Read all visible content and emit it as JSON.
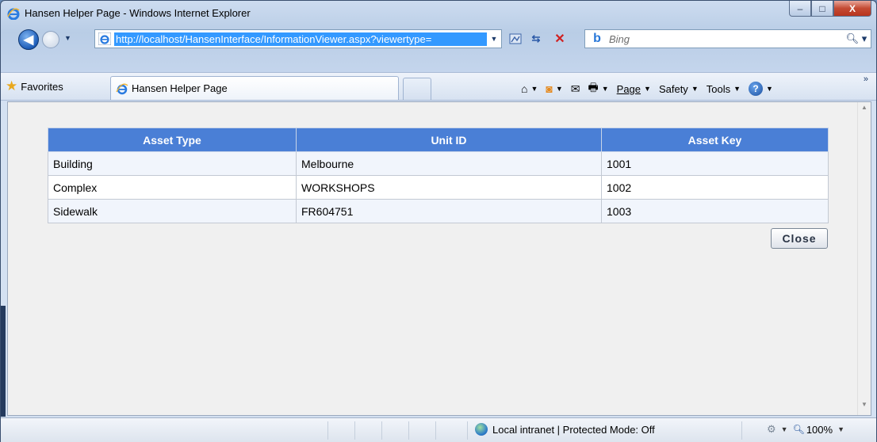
{
  "window": {
    "title": "Hansen Helper Page - Windows Internet Explorer",
    "controls": {
      "minimize": "–",
      "maximize": "□",
      "close": "X"
    }
  },
  "navigation": {
    "back_glyph": "◀",
    "address": "http://localhost/HansenInterface/InformationViewer.aspx?viewertype=",
    "search_placeholder": "Bing",
    "search_glyph": "⌕"
  },
  "favorites_bar": {
    "favorites_label": "Favorites",
    "tab_title": "Hansen Helper Page",
    "commands": [
      {
        "label": "Page"
      },
      {
        "label": "Safety"
      },
      {
        "label": "Tools"
      }
    ],
    "more_glyph": "»"
  },
  "grid": {
    "headers": [
      "Asset Type",
      "Unit ID",
      "Asset Key"
    ],
    "rows": [
      [
        "Building",
        "Melbourne",
        "1001"
      ],
      [
        "Complex",
        "WORKSHOPS",
        "1002"
      ],
      [
        "Sidewalk",
        "FR604751",
        "1003"
      ]
    ],
    "header_color": "#4a7fd6"
  },
  "close_button_label": "Close",
  "status_bar": {
    "zone": "Local intranet | Protected Mode: Off",
    "zoom": "100%"
  }
}
